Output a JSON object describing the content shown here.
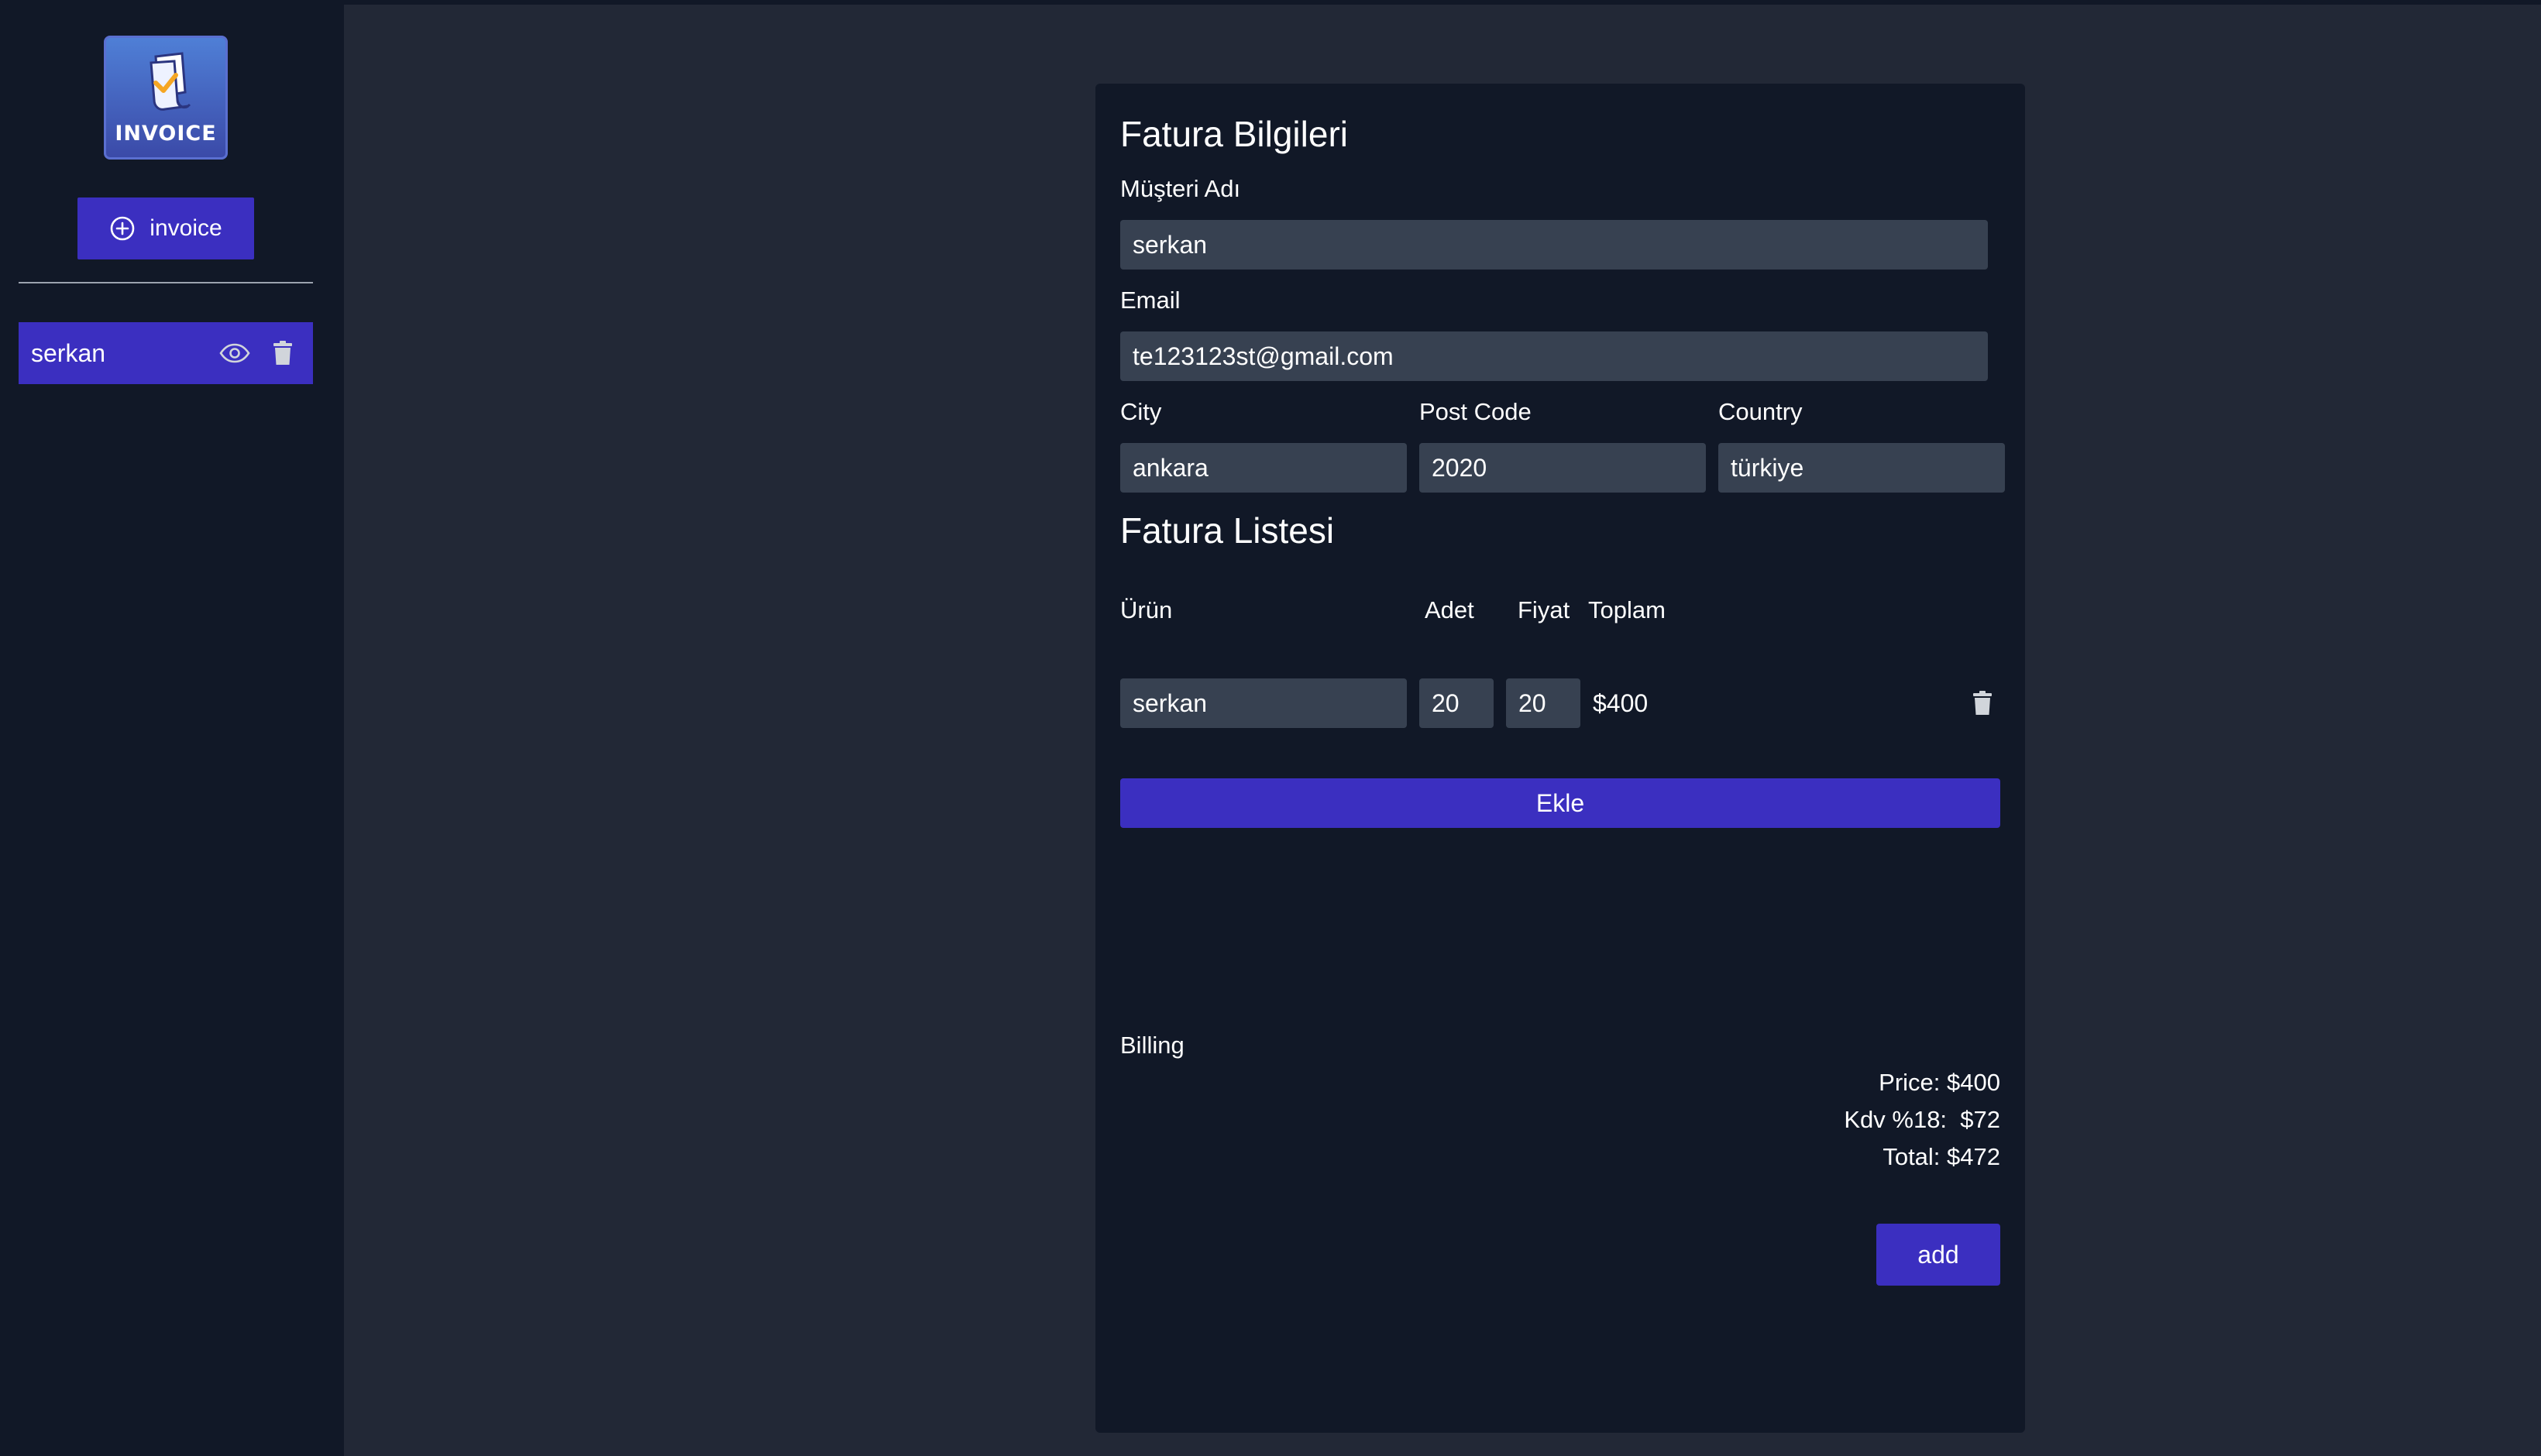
{
  "sidebar": {
    "logo_text": "INVOICE",
    "new_button_label": "invoice",
    "items": [
      {
        "label": "serkan"
      }
    ]
  },
  "form": {
    "title": "Fatura Bilgileri",
    "customer_label": "Müşteri Adı",
    "customer_value": "serkan",
    "email_label": "Email",
    "email_value": "te123123st@gmail.com",
    "city_label": "City",
    "city_value": "ankara",
    "postcode_label": "Post Code",
    "postcode_value": "2020",
    "country_label": "Country",
    "country_value": "türkiye"
  },
  "list": {
    "title": "Fatura Listesi",
    "headers": {
      "product": "Ürün",
      "qty": "Adet",
      "price": "Fiyat",
      "total": "Toplam"
    },
    "rows": [
      {
        "product": "serkan",
        "qty": "20",
        "price": "20",
        "total": "$400"
      }
    ],
    "add_row_label": "Ekle"
  },
  "billing": {
    "title": "Billing",
    "price": "Price: $400",
    "kdv": "Kdv %18:  $72",
    "total": "Total: $472",
    "submit_label": "add"
  },
  "colors": {
    "accent": "#3b2fc0",
    "page_bg": "#222836",
    "panel_bg": "#111827",
    "input_bg": "#374151"
  }
}
